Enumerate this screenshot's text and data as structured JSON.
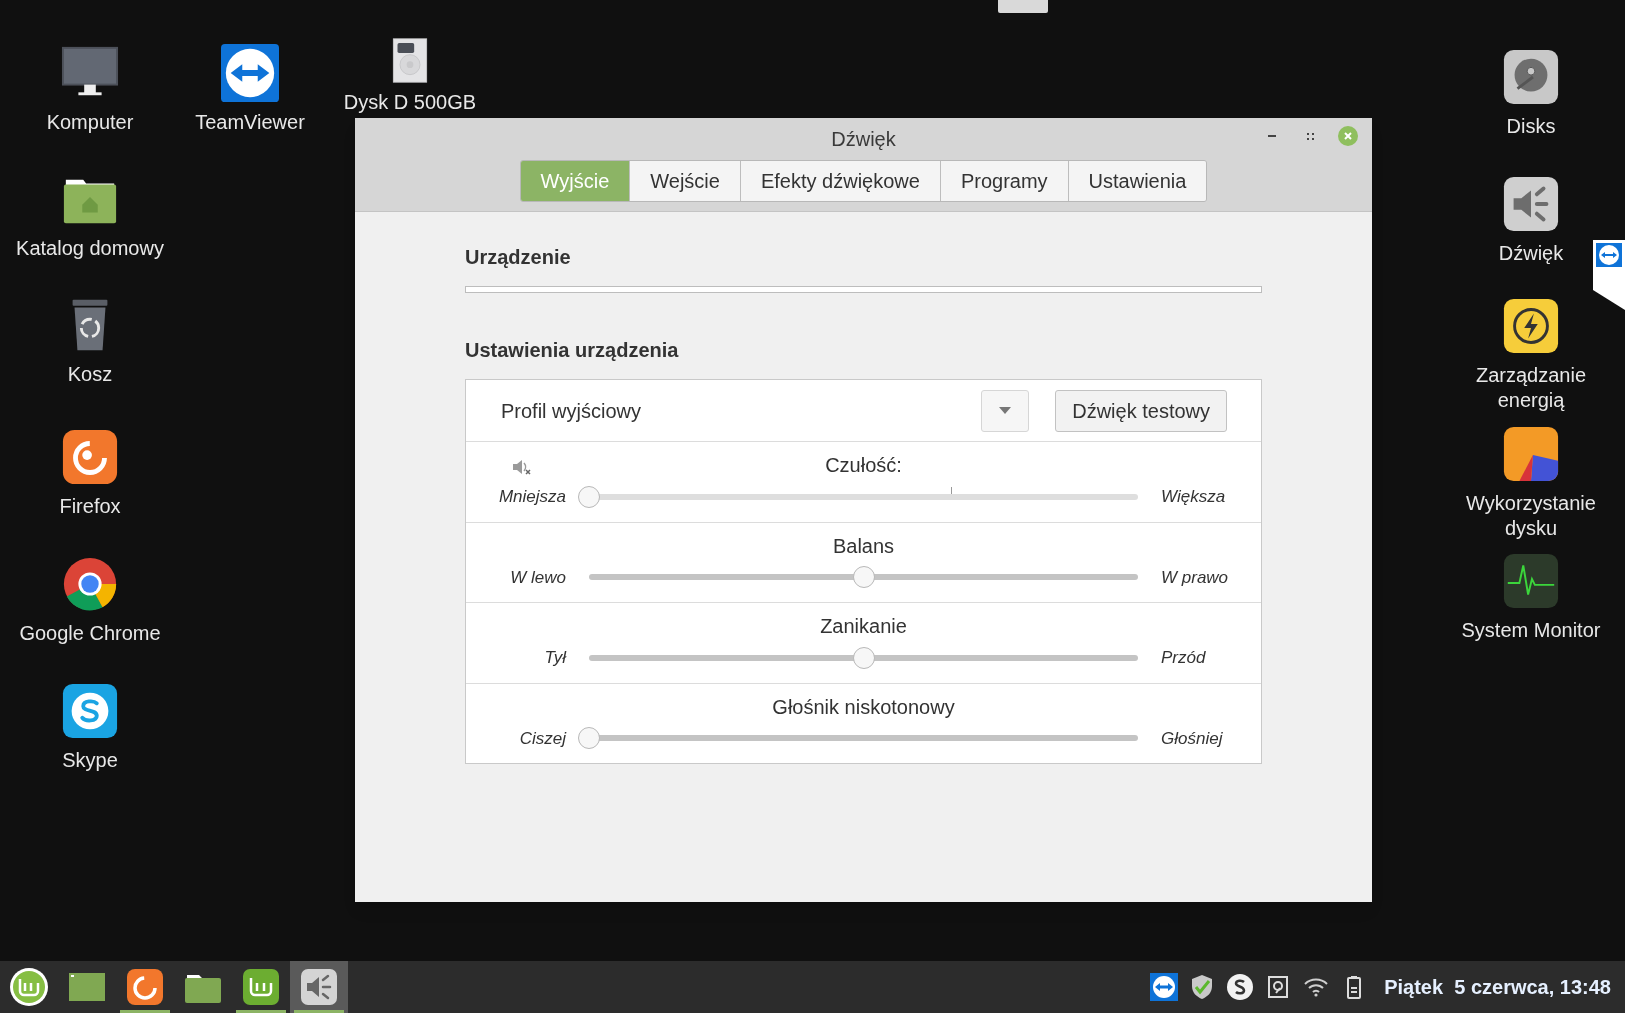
{
  "desktop": {
    "icons": [
      {
        "label": "Komputer",
        "kind": "monitor"
      },
      {
        "label": "TeamViewer",
        "kind": "teamviewer"
      },
      {
        "label": "Dysk D 500GB",
        "kind": "drive"
      },
      {
        "label": "Katalog domowy",
        "kind": "home-folder"
      },
      {
        "label": "Kosz",
        "kind": "trash"
      },
      {
        "label": "Firefox",
        "kind": "firefox"
      },
      {
        "label": "Google Chrome",
        "kind": "chrome"
      },
      {
        "label": "Skype",
        "kind": "skype"
      },
      {
        "label": "Disks",
        "kind": "disks"
      },
      {
        "label": "Dźwięk",
        "kind": "sound"
      },
      {
        "label": "Zarządzanie energią",
        "kind": "power"
      },
      {
        "label": "Wykorzystanie dysku",
        "kind": "disk-usage"
      },
      {
        "label": "System Monitor",
        "kind": "system-monitor"
      }
    ]
  },
  "window": {
    "title": "Dźwięk",
    "tabs": [
      {
        "label": "Wyjście",
        "selected": true
      },
      {
        "label": "Wejście",
        "selected": false
      },
      {
        "label": "Efekty dźwiękowe",
        "selected": false
      },
      {
        "label": "Programy",
        "selected": false
      },
      {
        "label": "Ustawienia",
        "selected": false
      }
    ],
    "device_heading": "Urządzenie",
    "settings_heading": "Ustawienia urządzenia",
    "profile": {
      "label": "Profil wyjściowy",
      "button": "Dźwięk testowy"
    },
    "sliders": [
      {
        "kind": "volume",
        "title": "Czułość:",
        "left": "Mniejsza",
        "right": "Większa",
        "level": 0
      },
      {
        "kind": "plain",
        "title": "Balans",
        "left": "W lewo",
        "right": "W prawo",
        "level": 0.5
      },
      {
        "kind": "plain",
        "title": "Zanikanie",
        "left": "Tył",
        "right": "Przód",
        "level": 0.5
      },
      {
        "kind": "plain",
        "title": "Głośnik niskotonowy",
        "left": "Ciszej",
        "right": "Głośniej",
        "level": 0
      }
    ]
  },
  "taskbar": {
    "apps": [
      {
        "kind": "menu",
        "running": false,
        "selected": false
      },
      {
        "kind": "desktop",
        "running": false,
        "selected": false
      },
      {
        "kind": "firefox",
        "running": true,
        "selected": false
      },
      {
        "kind": "files",
        "running": false,
        "selected": false
      },
      {
        "kind": "mint",
        "running": true,
        "selected": false
      },
      {
        "kind": "sound",
        "running": true,
        "selected": true
      }
    ],
    "tray": [
      {
        "kind": "teamviewer"
      },
      {
        "kind": "shield"
      },
      {
        "kind": "skype"
      },
      {
        "kind": "updates"
      },
      {
        "kind": "wifi"
      },
      {
        "kind": "battery"
      }
    ],
    "clock": "Piątek  5 czerwca, 13:48"
  }
}
